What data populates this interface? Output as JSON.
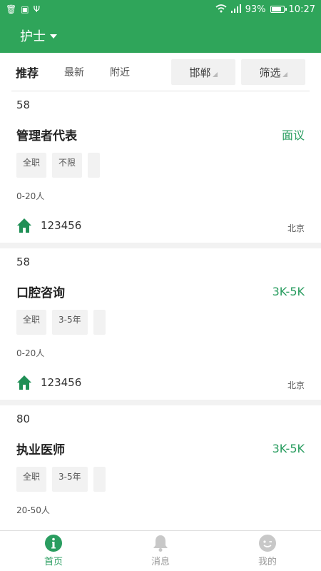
{
  "statusbar": {
    "battery": "93%",
    "battery_level": 0.93,
    "time": "10:27"
  },
  "appbar": {
    "role": "护士"
  },
  "filters": {
    "tabs": [
      "推荐",
      "最新",
      "附近"
    ],
    "city": "邯郸",
    "filter": "筛选"
  },
  "jobs": [
    {
      "num": "58",
      "title": "管理者代表",
      "salary": "面议",
      "tags": [
        "全职",
        "不限"
      ],
      "size": "0-20人",
      "company": "123456",
      "city": "北京"
    },
    {
      "num": "58",
      "title": "口腔咨询",
      "salary": "3K-5K",
      "tags": [
        "全职",
        "3-5年"
      ],
      "size": "0-20人",
      "company": "123456",
      "city": "北京"
    },
    {
      "num": "80",
      "title": "执业医师",
      "salary": "3K-5K",
      "tags": [
        "全职",
        "3-5年"
      ],
      "size": "20-50人",
      "company": "",
      "city": ""
    }
  ],
  "nav": [
    {
      "label": "首页",
      "icon": "home-info-icon",
      "active": true
    },
    {
      "label": "消息",
      "icon": "bell-icon",
      "active": false
    },
    {
      "label": "我的",
      "icon": "face-icon",
      "active": false
    }
  ],
  "colors": {
    "primary": "#2fa55a",
    "salary": "#2a9d60"
  }
}
